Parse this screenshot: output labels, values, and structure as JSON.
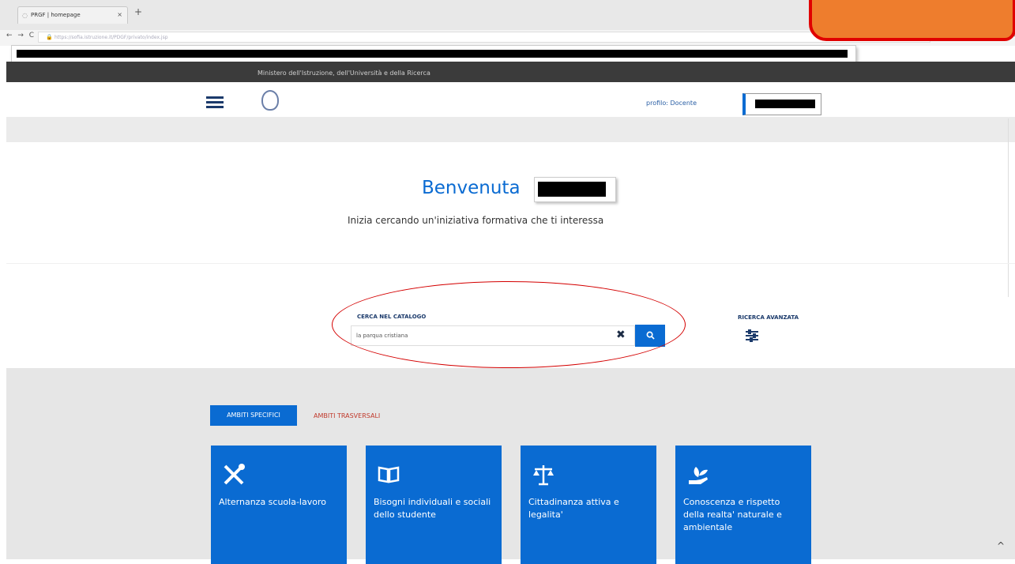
{
  "browser": {
    "tab_title": "PRGF | homepage",
    "tab_close": "×",
    "new_tab": "+",
    "nav": "← → C",
    "url": "https://sofia.istruzione.it/PDGF/privato/index.jsp",
    "tools": "☆ ⬇ ⌂ ≡"
  },
  "header": {
    "ministry": "Ministero dell'Istruzione, dell'Università e della Ricerca",
    "profile": "profilo: Docente"
  },
  "welcome": {
    "title": "Benvenuta",
    "subtitle": "Inizia cercando un'iniziativa formativa che ti interessa"
  },
  "search": {
    "label": "CERCA NEL CATALOGO",
    "value": "la parqua cristiana",
    "clear": "✖",
    "button": "🔍",
    "advanced_label": "RICERCA AVANZATA"
  },
  "tabs": {
    "specific": "AMBITI SPECIFICI",
    "transversal": "AMBITI TRASVERSALI"
  },
  "cards": [
    {
      "title": "Alternanza scuola-lavoro",
      "icon": "tools-icon"
    },
    {
      "title": "Bisogni individuali e sociali dello studente",
      "icon": "book-icon"
    },
    {
      "title": "Cittadinanza attiva e legalita'",
      "icon": "scales-icon"
    },
    {
      "title": "Conoscenza e rispetto della realta' naturale e ambientale",
      "icon": "plant-hand-icon"
    }
  ],
  "scroll_up": "^",
  "colors": {
    "accent": "#0a6bd2",
    "header_bar": "#3b3b3b",
    "annotation": "#d40000",
    "overlay": "#ee7d2d"
  }
}
